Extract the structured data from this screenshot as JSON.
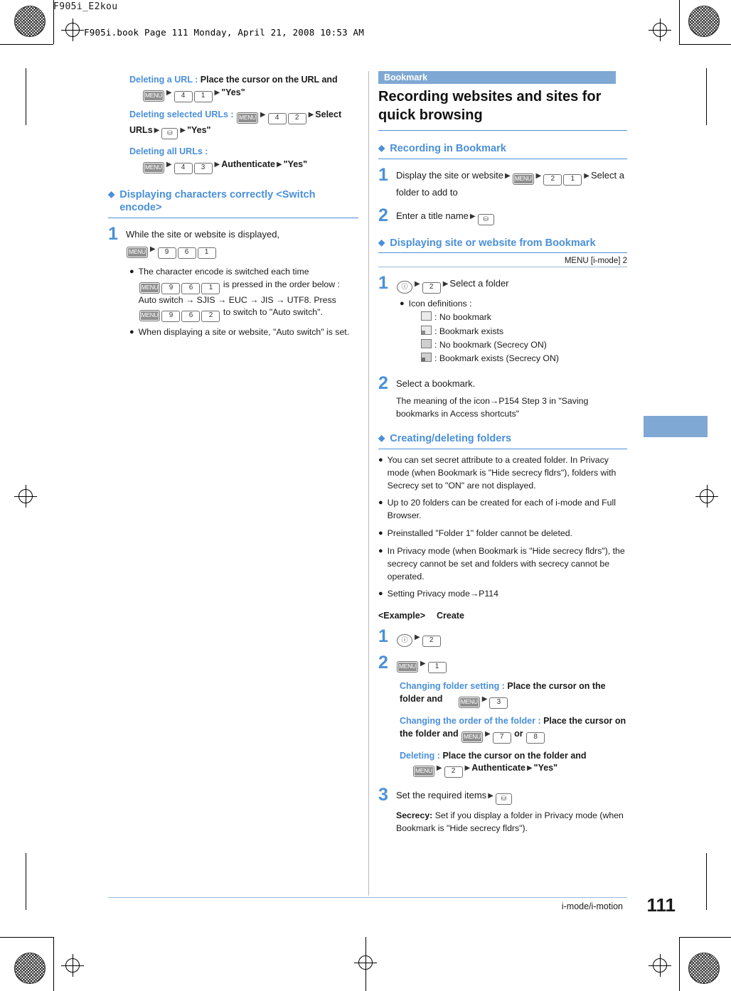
{
  "header": {
    "doc_title": "F905i_E2kou",
    "file_line": "F905i.book  Page 111  Monday, April 21, 2008  10:53 AM"
  },
  "left": {
    "notes_top": [
      {
        "head": "Deleting a URL :",
        "text": "Place the cursor on the URL and",
        "keys_line": [
          "MENU",
          "4",
          "1",
          "\"Yes\""
        ]
      },
      {
        "head": "Deleting selected URLs :",
        "text": "",
        "keys_line": [
          "MENU",
          "4",
          "2",
          "Select URLs",
          "i-sel",
          "\"Yes\""
        ]
      },
      {
        "head": "Deleting all URLs :",
        "text": "",
        "keys_line": [
          "MENU",
          "4",
          "3",
          "Authenticate",
          "\"Yes\""
        ]
      }
    ],
    "section1": {
      "title": "Displaying characters correctly <Switch encode>",
      "step1_text": "While the site or website is displayed,",
      "step1_keys": [
        "MENU",
        "9",
        "6",
        "1"
      ],
      "bullets": [
        "The character encode is switched each time  is pressed in the order below : Auto switch → SJIS → EUC → JIS → UTF8. Press  to switch to \"Auto switch\".",
        "When displaying a site or website, \"Auto switch\" is set."
      ],
      "bullet1_part1": "The character encode is switched each time",
      "bullet1_part2": "is pressed in the order below :",
      "bullet1_part3": "Auto switch → SJIS → EUC → JIS → UTF8. Press",
      "bullet1_part4": "to switch to \"Auto switch\".",
      "bullet2": "When displaying a site or website, \"Auto switch\" is set.",
      "keys_b1": [
        "MENU",
        "9",
        "6",
        "1"
      ],
      "keys_b2": [
        "MENU",
        "9",
        "6",
        "2"
      ]
    }
  },
  "right": {
    "tag": "Bookmark",
    "title": "Recording websites and sites for quick browsing",
    "sec_record": "Recording in Bookmark",
    "rec_step1": "Display the site or website",
    "rec_step1_keys": [
      "MENU",
      "2",
      "1"
    ],
    "rec_step1_tail": "Select a folder to add to",
    "rec_step2": "Enter a title name",
    "rec_step2_key": "i-sel",
    "sec_display": "Displaying site or website from Bookmark",
    "menu_label": "MENU [i-mode] 2",
    "disp_step1_keys": [
      "i-mode",
      "2"
    ],
    "disp_step1_tail": "Select a folder",
    "icon_defs_label": "Icon definitions :",
    "icon_defs": [
      ": No bookmark",
      ": Bookmark exists",
      ": No bookmark (Secrecy ON)",
      ": Bookmark exists (Secrecy ON)"
    ],
    "disp_step2": "Select a bookmark.",
    "disp_step2_note": "The meaning of the icon→P154 Step 3 in \"Saving bookmarks in Access shortcuts\"",
    "sec_folders": "Creating/deleting folders",
    "folder_notes": [
      "You can set secret attribute to a created folder. In Privacy mode (when Bookmark is \"Hide secrecy fldrs\"), folders with Secrecy set to \"ON\" are not displayed.",
      "Up to 20 folders can be created for each of i-mode and Full Browser.",
      "Preinstalled \"Folder 1\" folder cannot be deleted.",
      "In Privacy mode (when Bookmark is \"Hide secrecy fldrs\"), the secrecy cannot be set and folders with secrecy cannot be operated.",
      "Setting Privacy mode→P114"
    ],
    "example_label": "<Example>",
    "example_word": "Create",
    "ex_step1_keys": [
      "i-mode",
      "2"
    ],
    "ex_step2_keys": [
      "MENU",
      "1"
    ],
    "ex_sub_notes": [
      {
        "head": "Changing folder setting :",
        "text": "Place the cursor on the folder and",
        "keys": [
          "MENU",
          "3"
        ]
      },
      {
        "head": "Changing the order of the folder :",
        "text": "Place the cursor on the folder and",
        "keys": [
          "MENU",
          "7",
          "or",
          "8"
        ]
      },
      {
        "head": "Deleting :",
        "text": "Place the cursor on the folder and",
        "keys": [
          "MENU",
          "2",
          "Authenticate",
          "\"Yes\""
        ]
      }
    ],
    "ex_step3": "Set the required items",
    "ex_step3_key": "i-sel",
    "ex_step3_note_head": "Secrecy:",
    "ex_step3_note": "Set if you display a folder in Privacy mode (when Bookmark is \"Hide secrecy fldrs\")."
  },
  "footer": {
    "label": "i-mode/i-motion",
    "page": "111"
  }
}
